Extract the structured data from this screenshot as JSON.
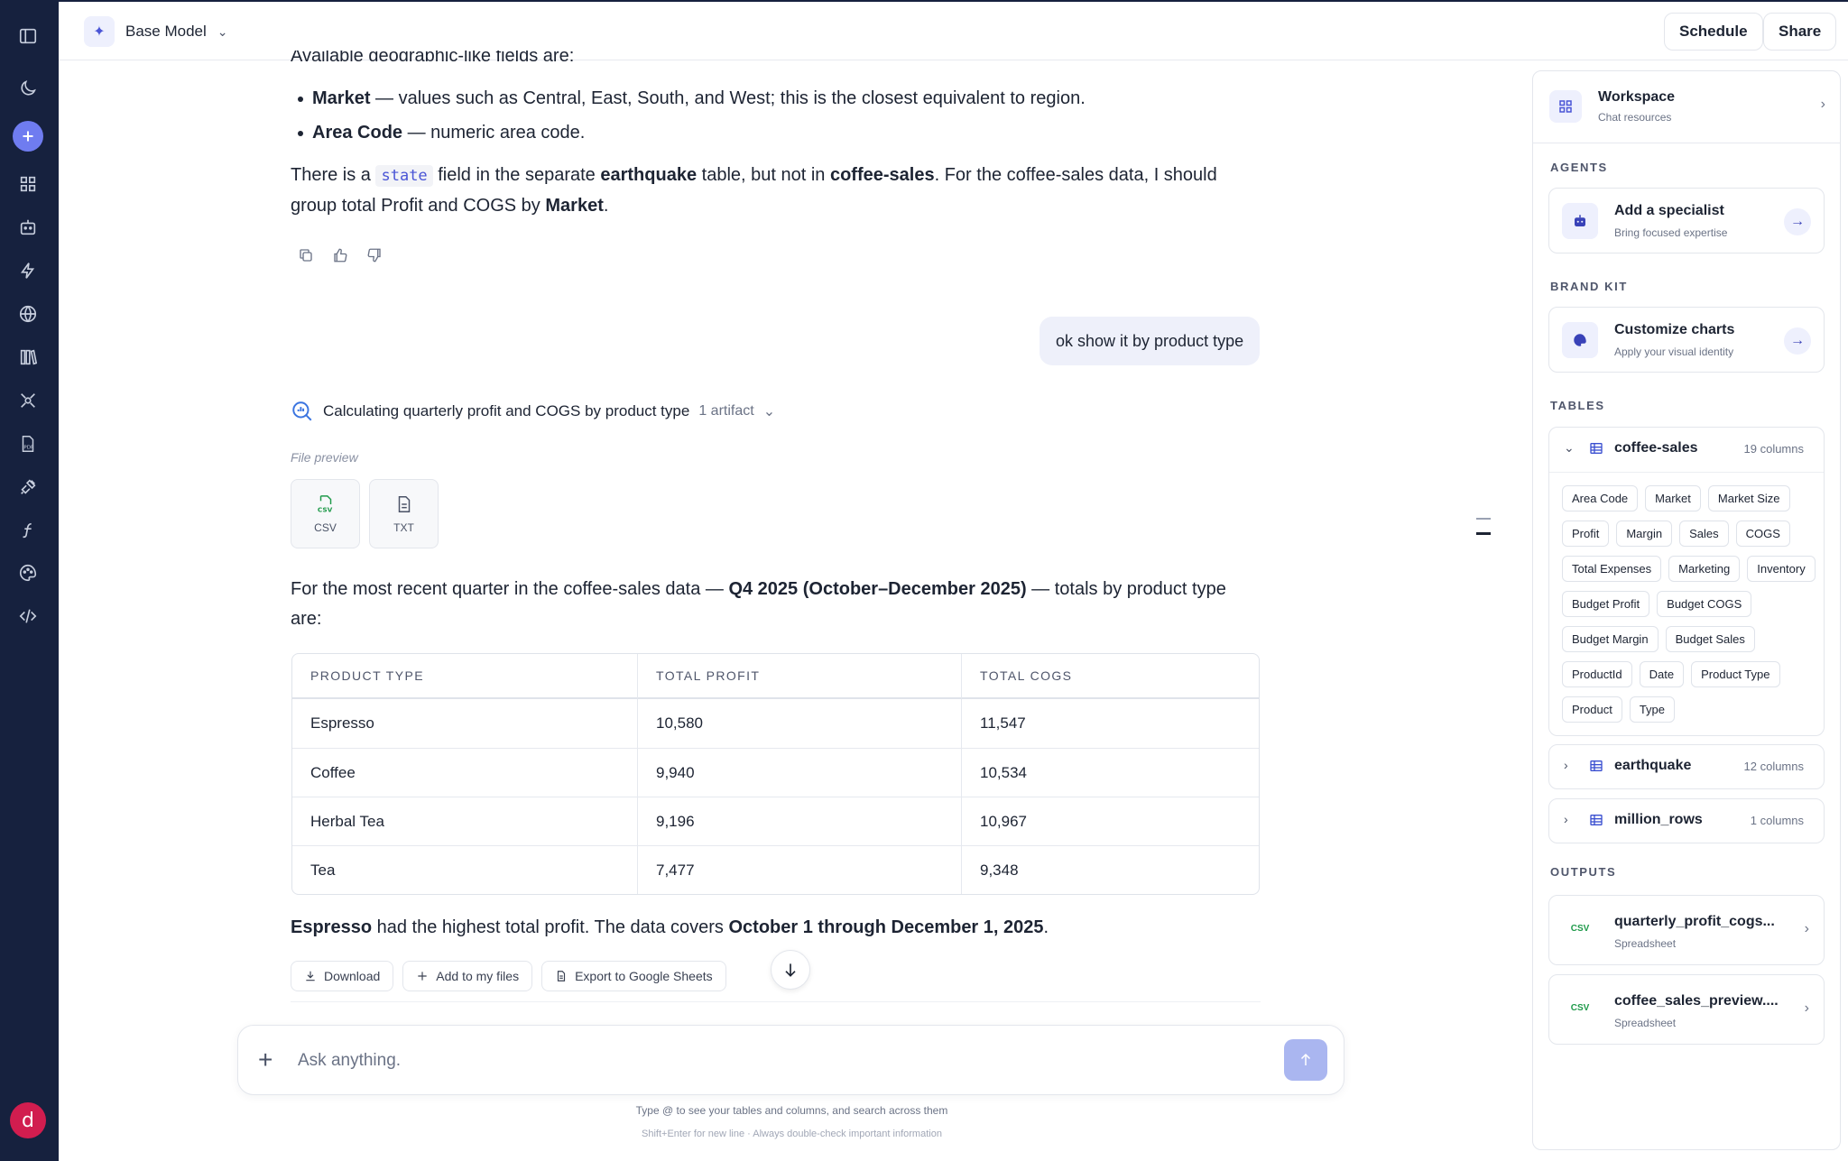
{
  "rail": {
    "avatar_letter": "d",
    "icons": [
      "sidebar-toggle-icon",
      "moon-icon",
      "plus-icon",
      "grid-icon",
      "robot-icon",
      "bolt-icon",
      "globe-icon",
      "library-icon",
      "satellite-icon",
      "pdf-icon",
      "plug-icon",
      "function-icon",
      "palette-icon",
      "code-icon"
    ]
  },
  "header": {
    "model_label": "Base Model",
    "schedule_label": "Schedule",
    "share_label": "Share"
  },
  "chat": {
    "clipped_line": "Available geographic-like fields are:",
    "bullets": [
      {
        "bold": "Market",
        "text": " — values such as Central, East, South, and West; this is the closest equivalent to region."
      },
      {
        "bold": "Area Code",
        "text": " — numeric area code."
      }
    ],
    "para1": {
      "a": "There is a ",
      "code": "state",
      "b": " field in the separate ",
      "bold1": "earthquake",
      "c": " table, but not in ",
      "bold2": "coffee-sales",
      "d": ". For the coffee-sales data, I should group total Profit and COGS by ",
      "bold3": "Market",
      "e": "."
    },
    "user_message": "ok show it by product type",
    "tool_title": "Calculating quarterly profit and COGS by product type",
    "tool_artifacts": "1 artifact",
    "file_preview_label": "File preview",
    "files": [
      {
        "icon_text": "CSV",
        "label": "CSV"
      },
      {
        "label": "TXT"
      }
    ],
    "para2": {
      "a": "For the most recent quarter in the coffee-sales data — ",
      "bold": "Q4 2025 (October–December 2025)",
      "b": " — totals by product type are:"
    },
    "table": {
      "headers": [
        "PRODUCT TYPE",
        "TOTAL PROFIT",
        "TOTAL COGS"
      ],
      "rows": [
        [
          "Espresso",
          "10,580",
          "11,547"
        ],
        [
          "Coffee",
          "9,940",
          "10,534"
        ],
        [
          "Herbal Tea",
          "9,196",
          "10,967"
        ],
        [
          "Tea",
          "7,477",
          "9,348"
        ]
      ]
    },
    "para3": {
      "bold1": "Espresso",
      "a": " had the highest total profit. The data covers ",
      "bold2": "October 1 through December 1, 2025",
      "b": "."
    },
    "actions": {
      "download": "Download",
      "add_files": "Add to my files",
      "export": "Export to Google Sheets"
    }
  },
  "composer": {
    "placeholder": "Ask anything.",
    "hint1": "Type @ to see your tables and columns, and search across them",
    "hint2": "Shift+Enter for new line · Always double-check important information"
  },
  "panel": {
    "workspace_title": "Workspace",
    "workspace_sub": "Chat resources",
    "agents_header": "AGENTS",
    "agent_title": "Add a specialist",
    "agent_sub": "Bring focused expertise",
    "brand_header": "BRAND KIT",
    "brand_title": "Customize charts",
    "brand_sub": "Apply your visual identity",
    "tables_header": "TABLES",
    "tables": [
      {
        "name": "coffee-sales",
        "count": "19 columns"
      },
      {
        "name": "earthquake",
        "count": "12 columns"
      },
      {
        "name": "million_rows",
        "count": "1 columns"
      }
    ],
    "columns": [
      "Area Code",
      "Market",
      "Market Size",
      "Profit",
      "Margin",
      "Sales",
      "COGS",
      "Total Expenses",
      "Marketing",
      "Inventory",
      "Budget Profit",
      "Budget COGS",
      "Budget Margin",
      "Budget Sales",
      "ProductId",
      "Date",
      "Product Type",
      "Product",
      "Type"
    ],
    "outputs_header": "OUTPUTS",
    "outputs": [
      {
        "name": "quarterly_profit_cogs...",
        "type": "Spreadsheet",
        "icon_text": "CSV"
      },
      {
        "name": "coffee_sales_preview....",
        "type": "Spreadsheet",
        "icon_text": "CSV"
      }
    ]
  }
}
